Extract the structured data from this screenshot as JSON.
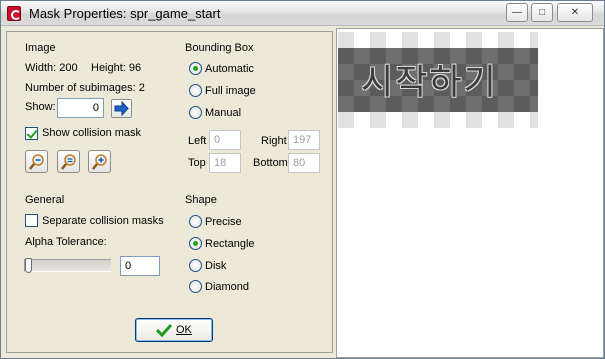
{
  "window": {
    "title": "Mask Properties: spr_game_start",
    "minimize_glyph": "—",
    "maximize_glyph": "□",
    "close_glyph": "✕"
  },
  "image": {
    "heading": "Image",
    "width_text": "Width: 200",
    "height_text": "Height: 96",
    "subimages_text": "Number of subimages: 2",
    "show_label": "Show:",
    "show_value": "0",
    "show_collision_label": "Show collision mask",
    "show_collision_checked": true,
    "zoom_buttons": [
      "zoom-out-icon",
      "zoom-reset-icon",
      "zoom-in-icon"
    ]
  },
  "general": {
    "heading": "General",
    "separate_masks_label": "Separate collision masks",
    "separate_masks_checked": false,
    "alpha_label": "Alpha Tolerance:",
    "alpha_value": "0",
    "alpha_fraction": 0
  },
  "bounding_box": {
    "heading": "Bounding Box",
    "options": [
      "Automatic",
      "Full image",
      "Manual"
    ],
    "selected": "Automatic",
    "left_label": "Left",
    "left_value": "0",
    "right_label": "Right",
    "right_value": "197",
    "top_label": "Top",
    "top_value": "18",
    "bottom_label": "Bottom",
    "bottom_value": "80"
  },
  "shape": {
    "heading": "Shape",
    "options": [
      "Precise",
      "Rectangle",
      "Disk",
      "Diamond"
    ],
    "selected": "Rectangle"
  },
  "ok_label": "OK",
  "preview": {
    "sprite_text": "시작하기"
  },
  "colors": {
    "window_bg": "#ece9d8",
    "accent_blue": "#1c5180",
    "check_green": "#21a121"
  }
}
